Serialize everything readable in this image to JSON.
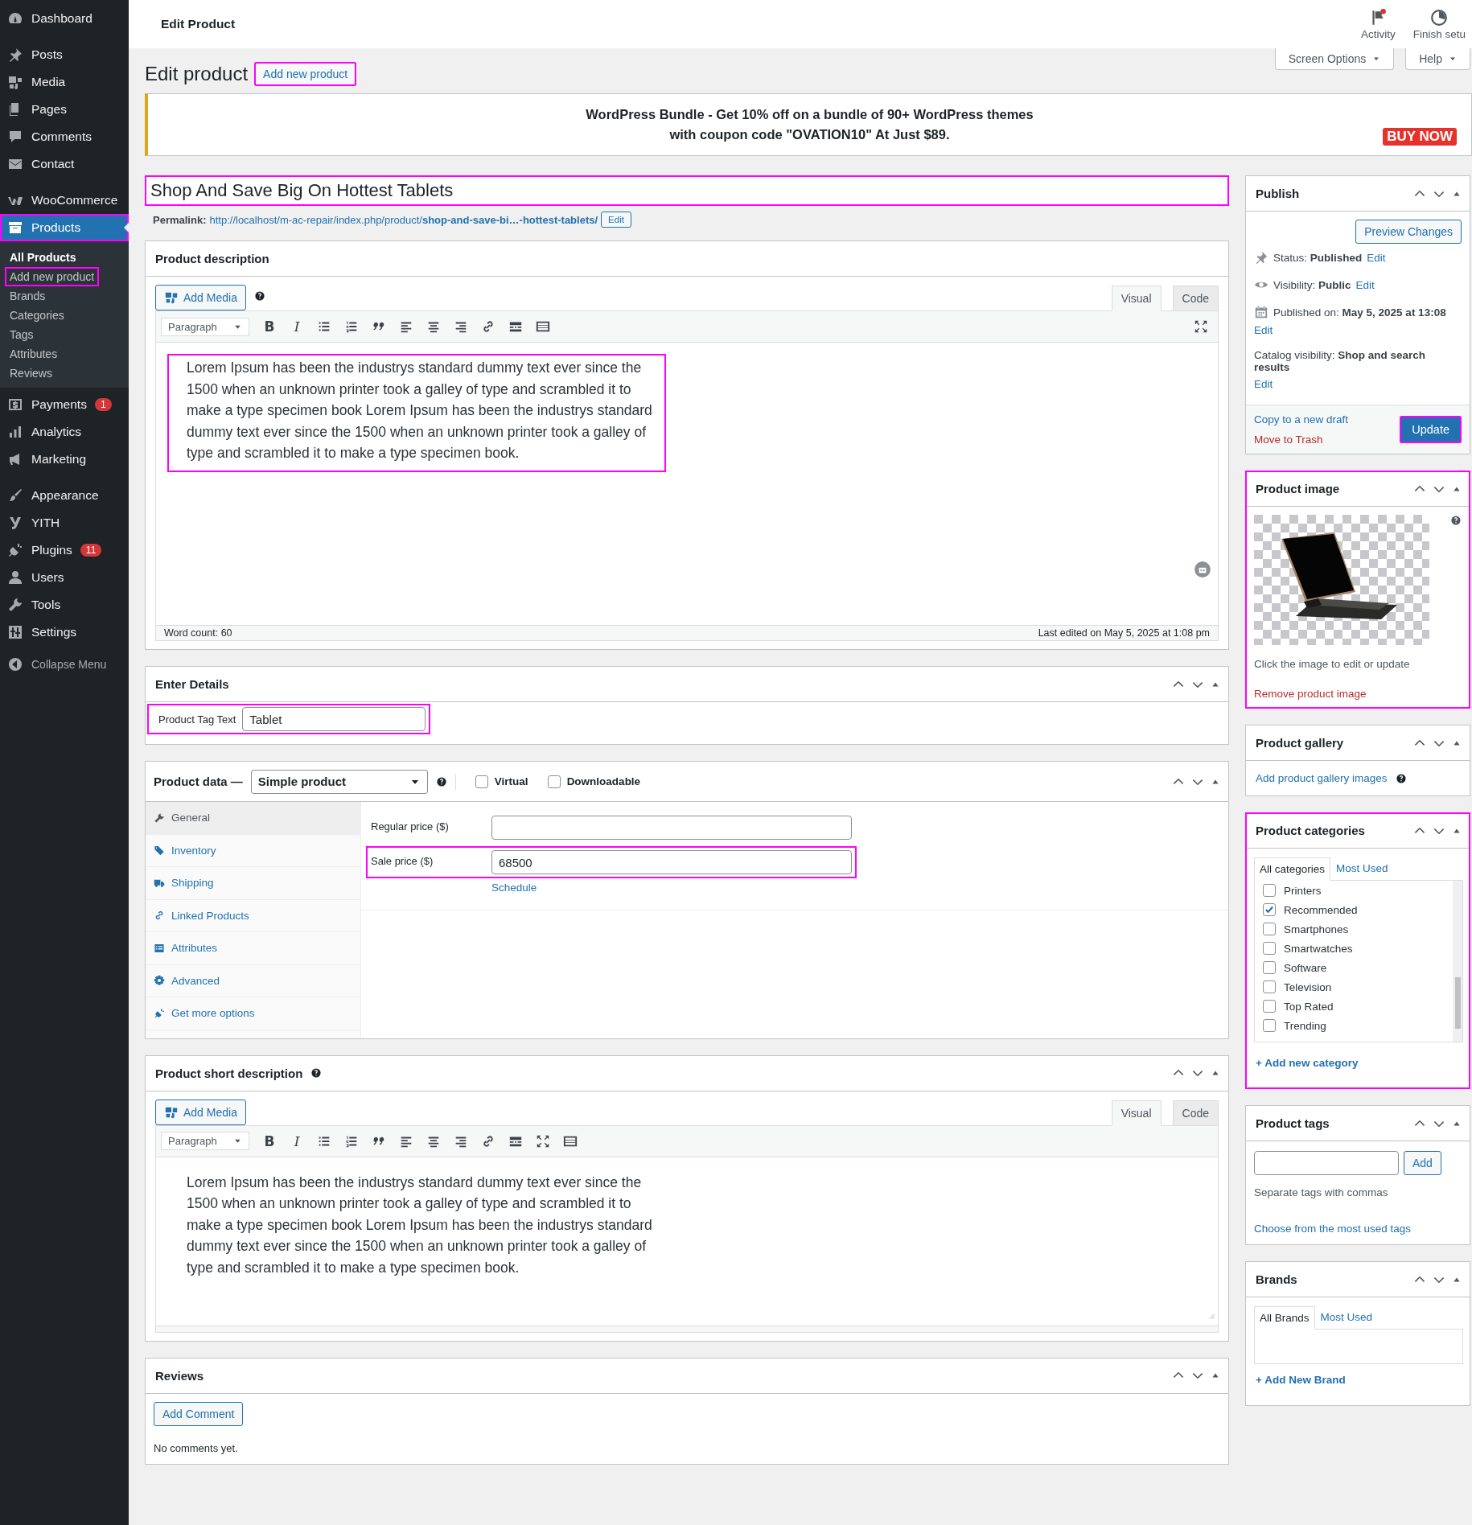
{
  "topbar": {
    "title": "Edit Product",
    "actions": [
      {
        "label": "Activity"
      },
      {
        "label": "Finish setu"
      }
    ]
  },
  "sidebar": {
    "groups": [
      [
        {
          "label": "Dashboard",
          "selected": false,
          "highlighted": false
        }
      ],
      [
        {
          "label": "Posts",
          "selected": false,
          "highlighted": false
        },
        {
          "label": "Media",
          "selected": false,
          "highlighted": false
        },
        {
          "label": "Pages",
          "selected": false,
          "highlighted": false
        },
        {
          "label": "Comments",
          "selected": false,
          "highlighted": false
        },
        {
          "label": "Contact",
          "selected": false,
          "highlighted": false
        }
      ],
      [
        {
          "label": "WooCommerce",
          "selected": false,
          "highlighted": false
        },
        {
          "label": "Products",
          "selected": true,
          "highlighted": true,
          "children": [
            {
              "label": "All Products",
              "selected": true,
              "highlighted": false
            },
            {
              "label": "Add new product",
              "selected": false,
              "highlighted": true
            },
            {
              "label": "Brands",
              "selected": false,
              "highlighted": false
            },
            {
              "label": "Categories",
              "selected": false,
              "highlighted": false
            },
            {
              "label": "Tags",
              "selected": false,
              "highlighted": false
            },
            {
              "label": "Attributes",
              "selected": false,
              "highlighted": false
            },
            {
              "label": "Reviews",
              "selected": false,
              "highlighted": false
            }
          ]
        },
        {
          "label": "Payments",
          "selected": false,
          "highlighted": false,
          "badge": "1"
        },
        {
          "label": "Analytics",
          "selected": false,
          "highlighted": false
        },
        {
          "label": "Marketing",
          "selected": false,
          "highlighted": false
        }
      ],
      [
        {
          "label": "Appearance",
          "selected": false,
          "highlighted": false
        },
        {
          "label": "YITH",
          "selected": false,
          "highlighted": false
        },
        {
          "label": "Plugins",
          "selected": false,
          "highlighted": false,
          "badge": "11"
        },
        {
          "label": "Users",
          "selected": false,
          "highlighted": false
        },
        {
          "label": "Tools",
          "selected": false,
          "highlighted": false
        },
        {
          "label": "Settings",
          "selected": false,
          "highlighted": false
        }
      ]
    ],
    "collapse": "Collapse Menu"
  },
  "header": {
    "title": "Edit product",
    "add_button": {
      "label": "Add new product",
      "highlighted": true
    },
    "screen_options": "Screen Options",
    "help": "Help"
  },
  "banner": {
    "lines": [
      "WordPress Bundle - Get 10% off on a bundle of 90+ WordPress themes",
      "with coupon code \"OVATION10\" At Just $89."
    ],
    "button": "BUY NOW"
  },
  "title_field": {
    "value": "Shop And Save Big On Hottest Tablets",
    "highlighted": true
  },
  "permalink": {
    "label": "Permalink:",
    "url": "http://localhost/m-ac-repair/index.php/product/**shop-and-save-bi…-hottest-tablets/**",
    "edit": "Edit"
  },
  "description": {
    "title": "Product description",
    "add_media": "Add Media",
    "tabs": [
      {
        "label": "Visual",
        "selected": true
      },
      {
        "label": "Code",
        "selected": false
      }
    ],
    "format": "Paragraph",
    "toolbar": [
      {
        "kind": "bold",
        "label": "B"
      },
      {
        "kind": "italic",
        "label": "I"
      },
      {
        "kind": "bullets"
      },
      {
        "kind": "numbers"
      },
      {
        "kind": "quote"
      },
      {
        "kind": "align-left"
      },
      {
        "kind": "align-center"
      },
      {
        "kind": "align-right"
      },
      {
        "kind": "link"
      },
      {
        "kind": "more"
      },
      {
        "kind": "toolbar"
      }
    ],
    "toolbar_end": [
      {
        "kind": "fullscreen"
      }
    ],
    "text": "Lorem Ipsum has been the industrys standard dummy text ever since the 1500 when an unknown printer took a galley of type and scrambled it to make a type specimen book Lorem Ipsum has been the industrys standard dummy text ever since the 1500 when an unknown printer took a galley of type and scrambled it to make a type specimen book.",
    "highlighted": true,
    "word_count": "Word count: 60",
    "last_edited": "Last edited on May 5, 2025 at 1:08 pm"
  },
  "details": {
    "title": "Enter Details",
    "field": {
      "label": "Product Tag Text",
      "value": "Tablet",
      "highlighted": true
    }
  },
  "product_data": {
    "title": "Product data —",
    "type": "Simple product",
    "options": [
      {
        "label": "Virtual",
        "checked": false
      },
      {
        "label": "Downloadable",
        "checked": false
      }
    ],
    "tabs": [
      {
        "label": "General",
        "selected": true
      },
      {
        "label": "Inventory",
        "selected": false
      },
      {
        "label": "Shipping",
        "selected": false
      },
      {
        "label": "Linked Products",
        "selected": false
      },
      {
        "label": "Attributes",
        "selected": false
      },
      {
        "label": "Advanced",
        "selected": false
      },
      {
        "label": "Get more options",
        "selected": false
      }
    ],
    "fields": [
      {
        "label": "Regular price ($)",
        "highlighted": false
      },
      {
        "label": "Sale price ($)",
        "value": "68500",
        "link": "Schedule",
        "highlighted": true
      }
    ]
  },
  "short_description": {
    "title": "Product short description",
    "add_media": "Add Media",
    "tabs": [
      {
        "label": "Visual",
        "selected": true
      },
      {
        "label": "Code",
        "selected": false
      }
    ],
    "format": "Paragraph",
    "toolbar": [
      {
        "kind": "bold",
        "label": "B"
      },
      {
        "kind": "italic",
        "label": "I"
      },
      {
        "kind": "bullets"
      },
      {
        "kind": "numbers"
      },
      {
        "kind": "quote"
      },
      {
        "kind": "align-left"
      },
      {
        "kind": "align-center"
      },
      {
        "kind": "align-right"
      },
      {
        "kind": "link"
      },
      {
        "kind": "more"
      },
      {
        "kind": "fullscreen"
      },
      {
        "kind": "toolbar"
      }
    ],
    "text": "Lorem Ipsum has been the industrys standard dummy text ever since the 1500 when an unknown printer took a galley of type and scrambled it to make a type specimen book Lorem Ipsum has been the industrys standard dummy text ever since the 1500 when an unknown printer took a galley of type and scrambled it to make a type specimen book."
  },
  "reviews": {
    "title": "Reviews",
    "button": "Add Comment",
    "empty": "No comments yet."
  },
  "publish": {
    "title": "Publish",
    "preview": "Preview Changes",
    "rows": [
      {
        "kind": "status",
        "text": "Status: **Published**",
        "link": "Edit"
      },
      {
        "kind": "visibility",
        "text": "Visibility: **Public**",
        "link": "Edit"
      },
      {
        "kind": "date",
        "text": "Published on: **May 5, 2025 at 13:08**",
        "link": "Edit"
      },
      {
        "kind": "catalog",
        "text": "Catalog visibility: **Shop and search results**",
        "link": "Edit"
      }
    ],
    "copy": "Copy to a new draft",
    "trash": "Move to Trash",
    "update": {
      "label": "Update",
      "highlighted": true
    }
  },
  "product_image": {
    "title": "Product image",
    "hint": "Click the image to edit or update",
    "remove": "Remove product image",
    "highlighted": true
  },
  "gallery": {
    "title": "Product gallery",
    "link": "Add product gallery images"
  },
  "categories": {
    "title": "Product categories",
    "tabs": [
      {
        "label": "All categories",
        "selected": true
      },
      {
        "label": "Most Used",
        "selected": false
      }
    ],
    "items": [
      {
        "label": "Printers",
        "checked": false
      },
      {
        "label": "Recommended",
        "checked": true
      },
      {
        "label": "Smartphones",
        "checked": false
      },
      {
        "label": "Smartwatches",
        "checked": false
      },
      {
        "label": "Software",
        "checked": false
      },
      {
        "label": "Television",
        "checked": false
      },
      {
        "label": "Top Rated",
        "checked": false
      },
      {
        "label": "Trending",
        "checked": false
      }
    ],
    "add": "+ Add new category",
    "highlighted": true
  },
  "tags": {
    "title": "Product tags",
    "button": "Add",
    "hint": "Separate tags with commas",
    "link": "Choose from the most used tags"
  },
  "brands": {
    "title": "Brands",
    "tabs": [
      {
        "label": "All Brands",
        "selected": true
      },
      {
        "label": "Most Used",
        "selected": false
      }
    ],
    "add": "+ Add New Brand"
  }
}
